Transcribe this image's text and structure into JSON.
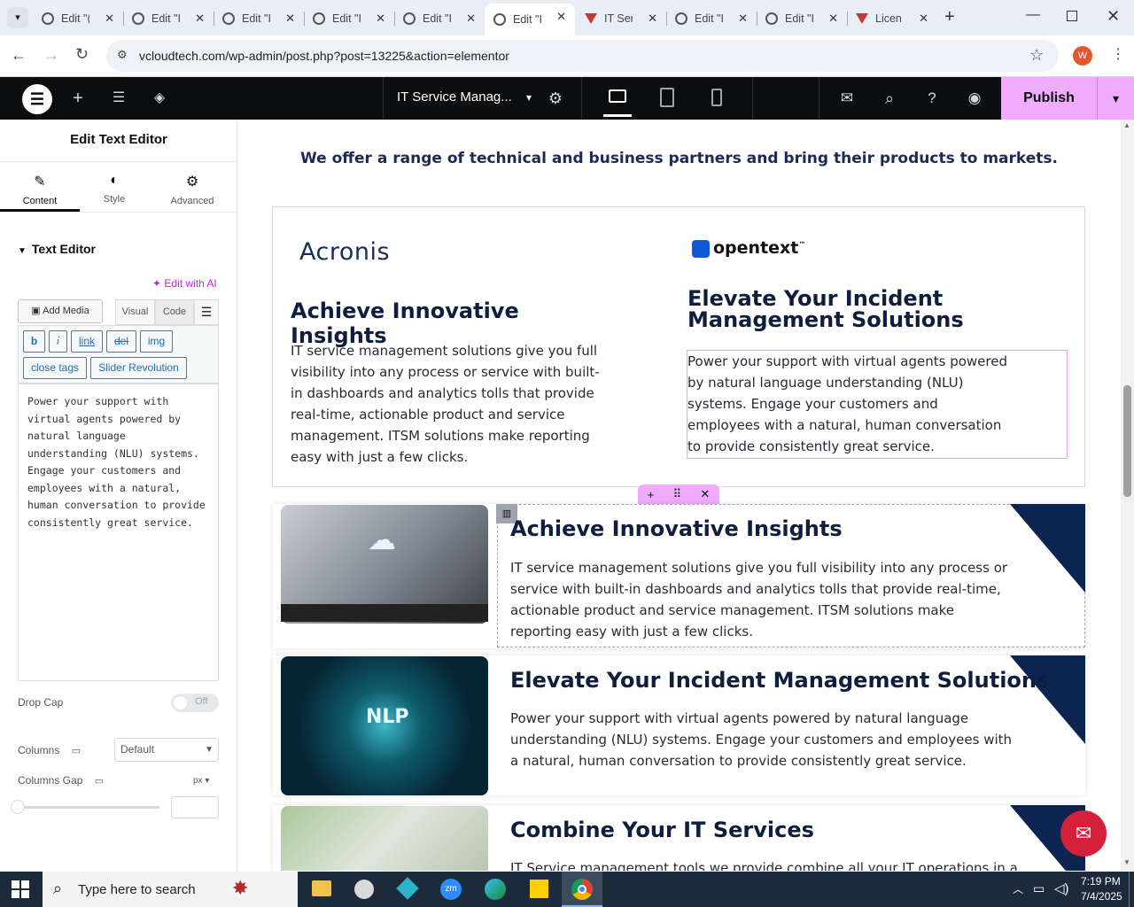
{
  "browser": {
    "tabs": [
      {
        "title": "Edit \"(",
        "icon": "wordpress-icon"
      },
      {
        "title": "Edit \"I",
        "icon": "wordpress-icon"
      },
      {
        "title": "Edit \"I",
        "icon": "wordpress-icon"
      },
      {
        "title": "Edit \"I",
        "icon": "wordpress-icon"
      },
      {
        "title": "Edit \"I",
        "icon": "wordpress-icon"
      },
      {
        "title": "Edit \"I",
        "icon": "wordpress-icon",
        "active": true
      },
      {
        "title": "IT Ser",
        "icon": "site-icon"
      },
      {
        "title": "Edit \"I",
        "icon": "wordpress-icon"
      },
      {
        "title": "Edit \"I",
        "icon": "wordpress-icon"
      },
      {
        "title": "Licen",
        "icon": "site-icon"
      }
    ],
    "url": "vcloudtech.com/wp-admin/post.php?post=13225&action=elementor",
    "profile_initial": "W"
  },
  "elementor_bar": {
    "page_title": "IT Service Manag...",
    "publish_label": "Publish"
  },
  "panel": {
    "header": "Edit Text Editor",
    "tabs": [
      "Content",
      "Style",
      "Advanced"
    ],
    "section_title": "Text Editor",
    "edit_with_ai": "Edit with AI",
    "add_media": "Add Media",
    "visual_tab": "Visual",
    "code_tab": "Code",
    "quicktags": [
      "b",
      "i",
      "link",
      "del",
      "img",
      "close tags",
      "Slider Revolution"
    ],
    "editor_text": "Power your support with virtual agents powered by natural language understanding (NLU) systems. Engage your customers and employees with a natural, human conversation to provide consistently great service.",
    "drop_cap_label": "Drop Cap",
    "drop_cap_state": "Off",
    "columns_label": "Columns",
    "columns_value": "Default",
    "columns_gap_label": "Columns Gap",
    "columns_gap_unit": "px"
  },
  "canvas": {
    "intro": "We offer a range of technical and business partners and bring their products to markets.",
    "partner_left": {
      "logo": "Acronis",
      "heading": "Achieve Innovative Insights",
      "text": "IT service management solutions give you full visibility into any process or service with built-in dashboards and analytics tolls that provide real-time, actionable product and service management. ITSM solutions make reporting easy with just a few clicks."
    },
    "partner_right": {
      "logo": "opentext",
      "logo_tm": "™",
      "heading": "Elevate Your Incident Management Solutions",
      "text": "Power your support with virtual agents powered by natural language understanding (NLU) systems. Engage your customers and employees with a natural, human conversation to provide consistently great service."
    },
    "cards": [
      {
        "heading": "Achieve Innovative Insights",
        "text": "IT service management solutions give you full visibility into any process or service with built-in dashboards and analytics tolls that provide real-time, actionable product and service management. ITSM solutions make reporting easy with just a few clicks."
      },
      {
        "heading": "Elevate Your Incident Management Solutions",
        "text": "Power your support with virtual agents powered by natural language understanding (NLU) systems. Engage your customers and employees with a natural, human conversation to provide consistently great service.",
        "image_label": "NLP"
      },
      {
        "heading": "Combine Your IT Services",
        "text": "IT Service management tools we provide combine all your IT operations in a"
      }
    ]
  },
  "taskbar": {
    "search_placeholder": "Type here to search",
    "time": "7:19 PM",
    "date": "7/4/2025"
  },
  "colors": {
    "accent_pink": "#f0abfc",
    "navy": "#0b2451",
    "chat_red": "#d61f3a"
  }
}
